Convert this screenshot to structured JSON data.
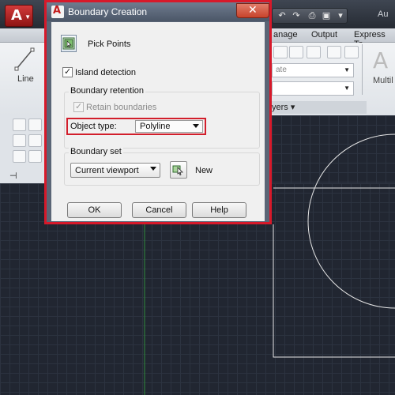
{
  "app": {
    "title_fragment": "Au",
    "ribbon_tabs": [
      "anage",
      "Output",
      "Express To"
    ],
    "line_tool_label": "Line",
    "multiline_label": "Multil",
    "layers_panel_label": "yers ▾",
    "layer_dropdown_text": "ate"
  },
  "dialog": {
    "title": "Boundary Creation",
    "pick_points_label": "Pick Points",
    "island_detection": {
      "label": "Island detection",
      "checked": true
    },
    "boundary_retention": {
      "title": "Boundary retention",
      "retain_boundaries": {
        "label": "Retain boundaries",
        "checked": true,
        "enabled": false
      },
      "object_type_label": "Object type:",
      "object_type_value": "Polyline"
    },
    "boundary_set": {
      "title": "Boundary set",
      "value": "Current viewport",
      "new_label": "New"
    },
    "buttons": {
      "ok": "OK",
      "cancel": "Cancel",
      "help": "Help"
    }
  },
  "colors": {
    "highlight_red": "#d21e2b",
    "drawing_background": "#212631",
    "ucs_axis_green": "#2e8b3a"
  }
}
